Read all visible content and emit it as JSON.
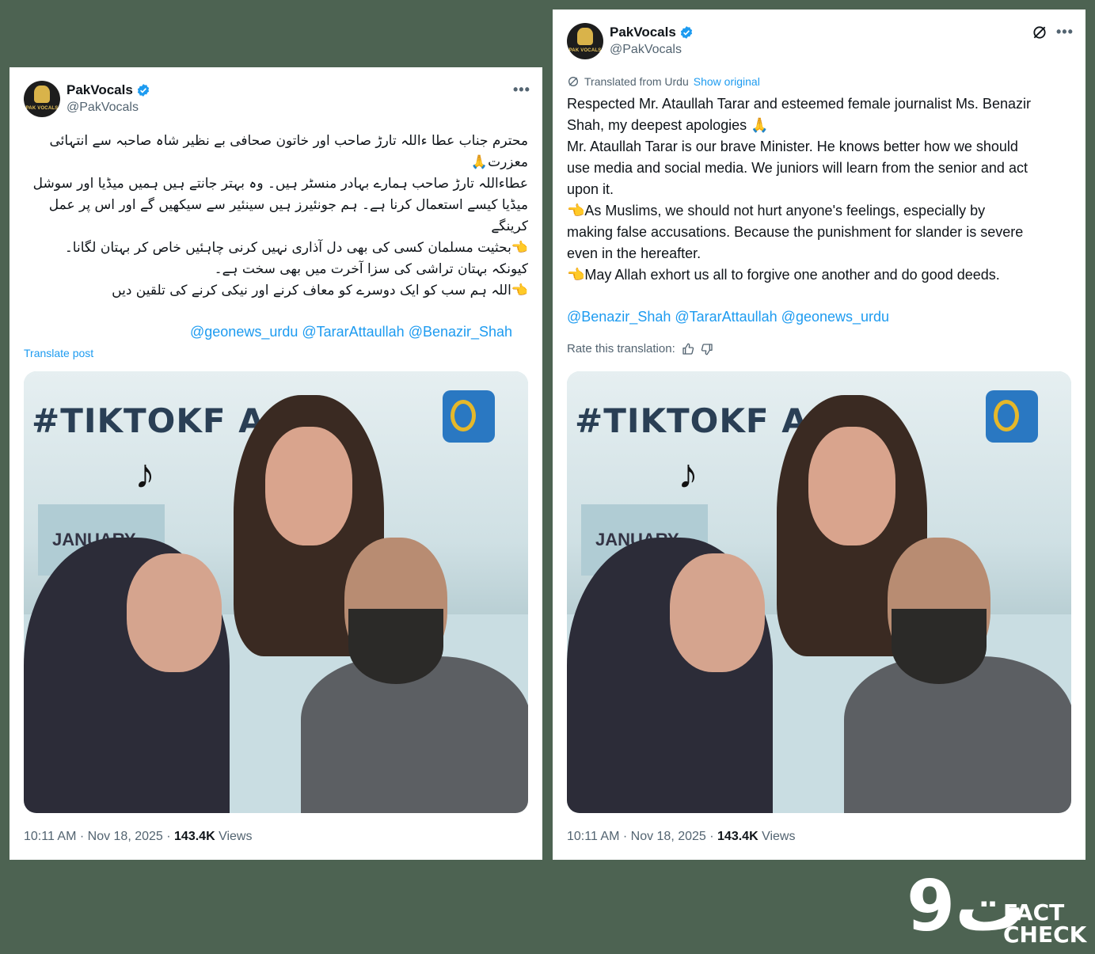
{
  "colors": {
    "background": "#4d6352",
    "link": "#1d9bf0",
    "text": "#0f1419",
    "muted": "#536471",
    "verified": "#1d9bf0"
  },
  "left_post": {
    "author_name": "PakVocals",
    "author_handle": "@PakVocals",
    "avatar_text": "PAK VOCALS",
    "more_label": "•••",
    "urdu_lines": [
      "محترم جناب عطا ءاللہ تارڑ صاحب اور خاتون صحافی بے نظیر شاہ صاحبہ سے انتہائی",
      "معزرت🙏",
      "عطاءاللہ تارڑ صاحب ہمارے بہادر منسٹر ہیں۔ وہ بہتر جانتے ہیں ہمیں میڈیا اور سوشل",
      "میڈیا کیسے استعمال کرنا ہے۔ ہم جونئیرز ہیں سینئیر سے سیکھیں گے اور اس پر عمل",
      "کرینگے",
      "👈بحثیت مسلمان کسی کی بھی دل آذاری نہیں کرنی چاہئیں خاص کر بہتان لگانا۔",
      "کیونکہ بہتان تراشی کی سزا آخرت میں بھی سخت ہے۔",
      "👈اللہ ہم سب کو ایک دوسرے کو معاف کرنے اور نیکی کرنے کی تلقین دیں"
    ],
    "mentions": "@geonews_urdu @TararAttaullah @Benazir_Shah",
    "translate_label": "Translate post",
    "photo_hashtag": "#TIKTOKF    ACE",
    "photo_banner": "JANUARY",
    "time": "10:11 AM · Nov 18, 2025 · ",
    "views_count": "143.4K",
    "views_label": " Views"
  },
  "right_post": {
    "author_name": "PakVocals",
    "author_handle": "@PakVocals",
    "avatar_text": "PAK VOCALS",
    "more_label": "•••",
    "translated_from": "Translated from Urdu",
    "show_original": "Show original",
    "en_lines": [
      "Respected Mr. Ataullah Tarar and esteemed female journalist Ms. Benazir",
      "Shah, my deepest apologies 🙏",
      "Mr. Ataullah Tarar is our brave Minister. He knows better how we should",
      "use media and social media. We juniors will learn from the senior and act",
      "upon it.",
      "👈As Muslims, we should not hurt anyone's feelings, especially by",
      "making false accusations. Because the punishment for slander is severe",
      "even in the hereafter.",
      "👈May Allah exhort us all to forgive one another and do good deeds."
    ],
    "mentions": "@Benazir_Shah @TararAttaullah @geonews_urdu",
    "rate_label": "Rate this translation:",
    "photo_hashtag": "#TIKTOKF    ACE",
    "photo_banner": "JANUARY",
    "time": "10:11 AM · Nov 18, 2025 · ",
    "views_count": "143.4K",
    "views_label": " Views"
  },
  "fact_check_logo": {
    "glyph": "ت9",
    "fact": "FACT",
    "check": "CHECK"
  }
}
